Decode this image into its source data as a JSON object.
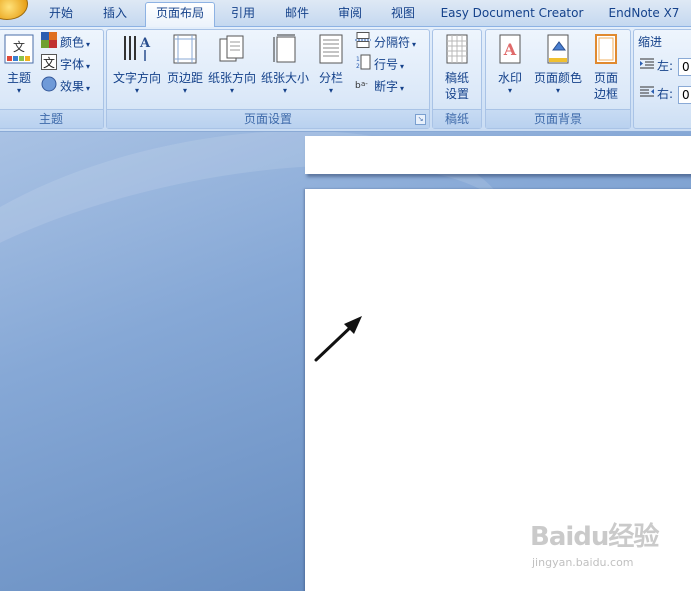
{
  "tabs": [
    {
      "label": "开始",
      "active": false
    },
    {
      "label": "插入",
      "active": false
    },
    {
      "label": "页面布局",
      "active": true
    },
    {
      "label": "引用",
      "active": false
    },
    {
      "label": "邮件",
      "active": false
    },
    {
      "label": "审阅",
      "active": false
    },
    {
      "label": "视图",
      "active": false
    },
    {
      "label": "Easy Document Creator",
      "active": false
    },
    {
      "label": "EndNote X7",
      "active": false
    }
  ],
  "groups": {
    "theme": {
      "label": "主题",
      "theme_button": "主题",
      "colors": "颜色",
      "fonts": "字体",
      "effects": "效果"
    },
    "page_setup": {
      "label": "页面设置",
      "text_direction": "文字方向",
      "margins": "页边距",
      "orientation": "纸张方向",
      "size": "纸张大小",
      "columns": "分栏",
      "breaks": "分隔符",
      "line_numbers": "行号",
      "hyphenation": "断字"
    },
    "draft_paper": {
      "label": "稿纸",
      "settings_line1": "稿纸",
      "settings_line2": "设置"
    },
    "page_background": {
      "label": "页面背景",
      "watermark": "水印",
      "page_color": "页面颜色",
      "page_border_line1": "页面",
      "page_border_line2": "边框"
    },
    "paragraph": {
      "indent_label": "缩进",
      "left": "左:",
      "right": "右:",
      "left_value": "0",
      "right_value": "0"
    }
  },
  "watermark": {
    "main": "Baidu经验",
    "sub": "jingyan.baidu.com"
  },
  "colors": {
    "accent": "#15428b",
    "ribbon_bg": "#d5e5f8",
    "workspace": "#6f94c6"
  }
}
